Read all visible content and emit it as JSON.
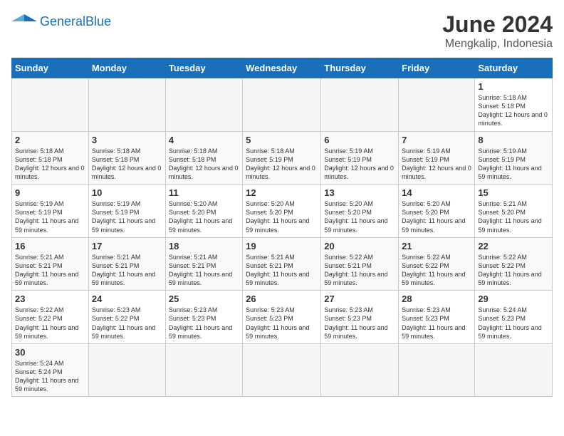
{
  "header": {
    "logo_general": "General",
    "logo_blue": "Blue",
    "title": "June 2024",
    "location": "Mengkalip, Indonesia"
  },
  "days_of_week": [
    "Sunday",
    "Monday",
    "Tuesday",
    "Wednesday",
    "Thursday",
    "Friday",
    "Saturday"
  ],
  "weeks": [
    [
      {
        "day": null,
        "sunrise": null,
        "sunset": null,
        "daylight": null
      },
      {
        "day": null,
        "sunrise": null,
        "sunset": null,
        "daylight": null
      },
      {
        "day": null,
        "sunrise": null,
        "sunset": null,
        "daylight": null
      },
      {
        "day": null,
        "sunrise": null,
        "sunset": null,
        "daylight": null
      },
      {
        "day": null,
        "sunrise": null,
        "sunset": null,
        "daylight": null
      },
      {
        "day": null,
        "sunrise": null,
        "sunset": null,
        "daylight": null
      },
      {
        "day": 1,
        "sunrise": "5:18 AM",
        "sunset": "5:18 PM",
        "daylight": "12 hours and 0 minutes."
      }
    ],
    [
      {
        "day": 2,
        "sunrise": "5:18 AM",
        "sunset": "5:18 PM",
        "daylight": "12 hours and 0 minutes."
      },
      {
        "day": 3,
        "sunrise": "5:18 AM",
        "sunset": "5:18 PM",
        "daylight": "12 hours and 0 minutes."
      },
      {
        "day": 4,
        "sunrise": "5:18 AM",
        "sunset": "5:18 PM",
        "daylight": "12 hours and 0 minutes."
      },
      {
        "day": 5,
        "sunrise": "5:18 AM",
        "sunset": "5:19 PM",
        "daylight": "12 hours and 0 minutes."
      },
      {
        "day": 6,
        "sunrise": "5:19 AM",
        "sunset": "5:19 PM",
        "daylight": "12 hours and 0 minutes."
      },
      {
        "day": 7,
        "sunrise": "5:19 AM",
        "sunset": "5:19 PM",
        "daylight": "12 hours and 0 minutes."
      },
      {
        "day": 8,
        "sunrise": "5:19 AM",
        "sunset": "5:19 PM",
        "daylight": "11 hours and 59 minutes."
      }
    ],
    [
      {
        "day": 9,
        "sunrise": "5:19 AM",
        "sunset": "5:19 PM",
        "daylight": "11 hours and 59 minutes."
      },
      {
        "day": 10,
        "sunrise": "5:19 AM",
        "sunset": "5:19 PM",
        "daylight": "11 hours and 59 minutes."
      },
      {
        "day": 11,
        "sunrise": "5:20 AM",
        "sunset": "5:20 PM",
        "daylight": "11 hours and 59 minutes."
      },
      {
        "day": 12,
        "sunrise": "5:20 AM",
        "sunset": "5:20 PM",
        "daylight": "11 hours and 59 minutes."
      },
      {
        "day": 13,
        "sunrise": "5:20 AM",
        "sunset": "5:20 PM",
        "daylight": "11 hours and 59 minutes."
      },
      {
        "day": 14,
        "sunrise": "5:20 AM",
        "sunset": "5:20 PM",
        "daylight": "11 hours and 59 minutes."
      },
      {
        "day": 15,
        "sunrise": "5:21 AM",
        "sunset": "5:20 PM",
        "daylight": "11 hours and 59 minutes."
      }
    ],
    [
      {
        "day": 16,
        "sunrise": "5:21 AM",
        "sunset": "5:21 PM",
        "daylight": "11 hours and 59 minutes."
      },
      {
        "day": 17,
        "sunrise": "5:21 AM",
        "sunset": "5:21 PM",
        "daylight": "11 hours and 59 minutes."
      },
      {
        "day": 18,
        "sunrise": "5:21 AM",
        "sunset": "5:21 PM",
        "daylight": "11 hours and 59 minutes."
      },
      {
        "day": 19,
        "sunrise": "5:21 AM",
        "sunset": "5:21 PM",
        "daylight": "11 hours and 59 minutes."
      },
      {
        "day": 20,
        "sunrise": "5:22 AM",
        "sunset": "5:21 PM",
        "daylight": "11 hours and 59 minutes."
      },
      {
        "day": 21,
        "sunrise": "5:22 AM",
        "sunset": "5:22 PM",
        "daylight": "11 hours and 59 minutes."
      },
      {
        "day": 22,
        "sunrise": "5:22 AM",
        "sunset": "5:22 PM",
        "daylight": "11 hours and 59 minutes."
      }
    ],
    [
      {
        "day": 23,
        "sunrise": "5:22 AM",
        "sunset": "5:22 PM",
        "daylight": "11 hours and 59 minutes."
      },
      {
        "day": 24,
        "sunrise": "5:23 AM",
        "sunset": "5:22 PM",
        "daylight": "11 hours and 59 minutes."
      },
      {
        "day": 25,
        "sunrise": "5:23 AM",
        "sunset": "5:23 PM",
        "daylight": "11 hours and 59 minutes."
      },
      {
        "day": 26,
        "sunrise": "5:23 AM",
        "sunset": "5:23 PM",
        "daylight": "11 hours and 59 minutes."
      },
      {
        "day": 27,
        "sunrise": "5:23 AM",
        "sunset": "5:23 PM",
        "daylight": "11 hours and 59 minutes."
      },
      {
        "day": 28,
        "sunrise": "5:23 AM",
        "sunset": "5:23 PM",
        "daylight": "11 hours and 59 minutes."
      },
      {
        "day": 29,
        "sunrise": "5:24 AM",
        "sunset": "5:23 PM",
        "daylight": "11 hours and 59 minutes."
      }
    ],
    [
      {
        "day": 30,
        "sunrise": "5:24 AM",
        "sunset": "5:24 PM",
        "daylight": "11 hours and 59 minutes."
      },
      {
        "day": null,
        "sunrise": null,
        "sunset": null,
        "daylight": null
      },
      {
        "day": null,
        "sunrise": null,
        "sunset": null,
        "daylight": null
      },
      {
        "day": null,
        "sunrise": null,
        "sunset": null,
        "daylight": null
      },
      {
        "day": null,
        "sunrise": null,
        "sunset": null,
        "daylight": null
      },
      {
        "day": null,
        "sunrise": null,
        "sunset": null,
        "daylight": null
      },
      {
        "day": null,
        "sunrise": null,
        "sunset": null,
        "daylight": null
      }
    ]
  ],
  "labels": {
    "sunrise": "Sunrise:",
    "sunset": "Sunset:",
    "daylight": "Daylight:"
  }
}
